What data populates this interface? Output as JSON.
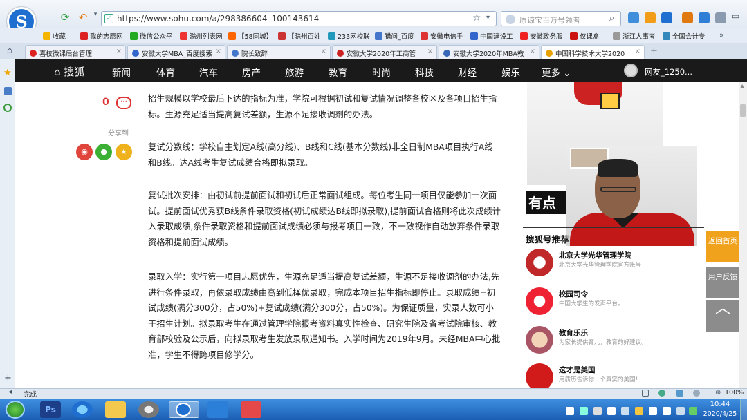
{
  "browser": {
    "url": "https://www.sohu.com/a/298386604_100143614",
    "search_placeholder": "原谅宝百万号领者",
    "bookmarks": [
      "收藏",
      "我的志愿网",
      "微信公众平",
      "滁州列表网",
      "【58同城】",
      "【滁州百姓",
      "233网校联",
      "猎问_百度",
      "安徽电信手",
      "中国建设工",
      "安徽政务服",
      "仅课盒",
      "浙江人事考",
      "全国会计专"
    ],
    "tabs": [
      "喜校微课后台管理",
      "安徽大学MBA_百度搜索",
      "院长致辞",
      "安徽大学2020年工商管",
      "安徽大学2020年MBA教",
      "中国科学技术大学2020"
    ],
    "status": "完成",
    "zoom": "100%"
  },
  "sohu_nav": {
    "logo": "搜狐",
    "items": [
      "新闻",
      "体育",
      "汽车",
      "房产",
      "旅游",
      "教育",
      "时尚",
      "科技",
      "财经",
      "娱乐"
    ],
    "more": "更多",
    "user": "网友_1250..."
  },
  "article": {
    "comment_count": "0",
    "share_label": "分享到",
    "paragraphs": [
      "招生规模以学校最后下达的指标为准，学院可根据初试和复试情况调整各校区及各项目招生指标。生源充足适当提高复试差额，生源不足接收调剂的办法。",
      "复试分数线：学校自主划定A线(高分线)、B线和C线(基本分数线)非全日制MBA项目执行A线和B线。达A线考生复试成绩合格即拟录取。",
      "复试批次安排：由初试前提前面试和初试后正常面试组成。每位考生同一项目仅能参加一次面试。提前面试优秀获B线条件录取资格(初试成绩达B线即拟录取),提前面试合格则将此次成绩计入录取成绩,条件录取资格和提前面试成绩必须与报考项目一致，不一致视作自动放弃条件录取资格和提前面试成绩。",
      "录取入学：实行第一项目志愿优先，生源充足适当提高复试差额，生源不足接收调剂的办法,先进行条件录取，再依录取成绩由高到低择优录取，完成本项目招生指标即停止。录取成绩=初试成绩(满分300分，占50%)+复试成绩(满分300分，占50%)。为保证质量，实录人数可小于招生计划。拟录取考生在通过管理学院报考资料真实性检查、研究生院及省考试院审核、教育部校验及公示后，向拟录取考生发放录取通知书。入学时间为2019年9月。未经MBA中心批准，学生不得跨项目修学分。"
    ]
  },
  "sidebar": {
    "banner_text": "有点",
    "rec_title": "搜狐号推荐",
    "recs": [
      {
        "name": "北京大学光华管理学院",
        "desc": "北京大学光华管理学院官方账号"
      },
      {
        "name": "校园司令",
        "desc": "中国大学生的发声平台。"
      },
      {
        "name": "教育乐乐",
        "desc": "为家长提供育儿，教育的好建议。"
      },
      {
        "name": "这才是美国",
        "desc": "用质历告诉你一个真实的美国！"
      }
    ]
  },
  "float_buttons": {
    "home": "返回首页",
    "feedback": "用户反馈"
  },
  "taskbar": {
    "time": "10:44",
    "date": "2020/4/25"
  },
  "colors": {
    "sohu_red": "#e03c24",
    "nav_bg": "#1a1a1a",
    "float_orange": "#f0a21c",
    "float_gray": "#8c8c8c"
  }
}
